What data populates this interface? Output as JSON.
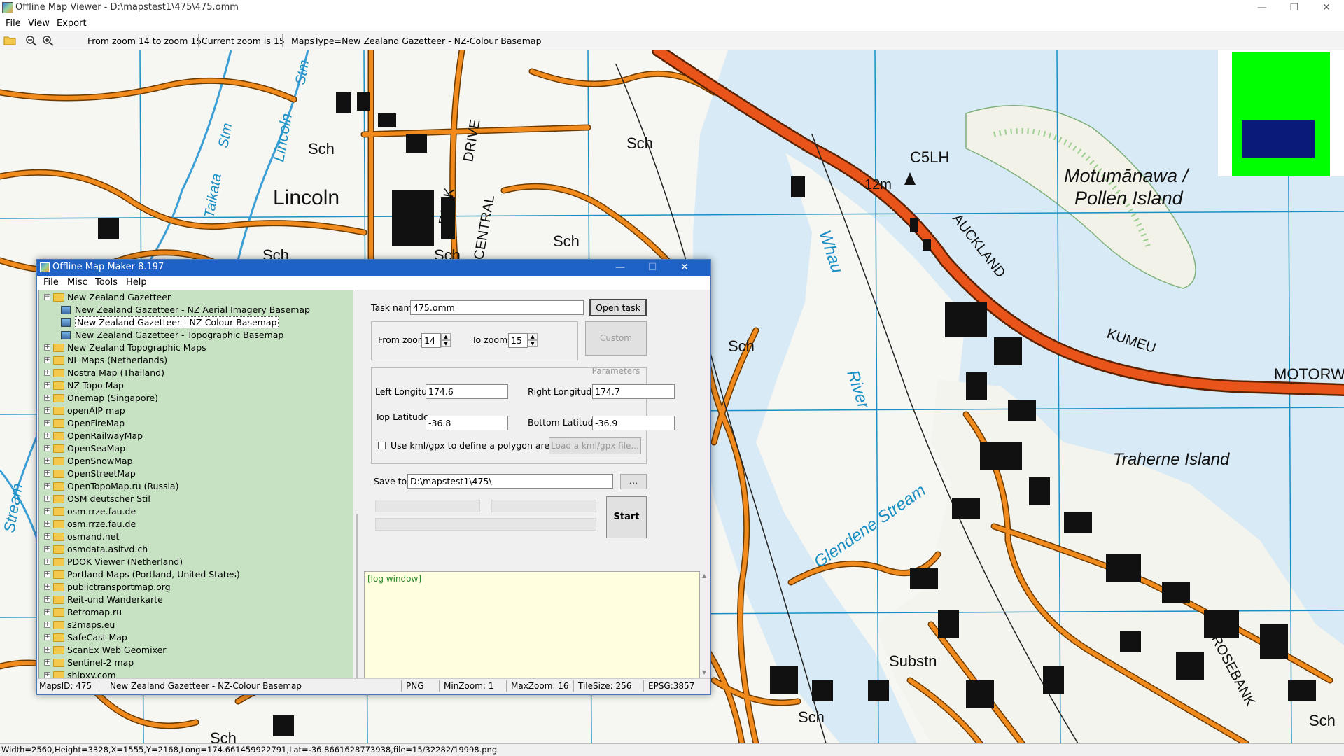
{
  "window": {
    "title": "Offline Map Viewer - D:\\mapstest1\\475\\475.omm",
    "controls": {
      "minimize": "—",
      "maximize": "❐",
      "close": "✕"
    }
  },
  "menu": [
    "File",
    "View",
    "Export"
  ],
  "toolbar": {
    "zoom_range": "From zoom 14 to zoom 15",
    "current_zoom": "Current zoom is 15",
    "maps_type": "MapsType=New Zealand Gazetteer - NZ-Colour Basemap",
    "icons": [
      "open-folder-icon",
      "zoom-out-icon",
      "zoom-in-icon"
    ]
  },
  "map_labels": [
    "Lincoln",
    "Sch",
    "Sch",
    "Sch",
    "Sch",
    "Sch",
    "Sch",
    "Sch",
    "Sch",
    "Sch",
    "C5LH",
    "12m",
    "Motumānawa /",
    "Pollen Island",
    "AUCKLAND",
    "KUMEU",
    "MOTORW",
    "Traherne Island",
    "Whau",
    "River",
    "Glendene Stream",
    "Substn",
    "ROSEBANK",
    "Stream",
    "Stm",
    "Lincoln",
    "Stm",
    "Taikata",
    "PARK",
    "CENTRAL",
    "DRIVE"
  ],
  "colors": {
    "road": "#f08a1c",
    "motorway": "#e8541a",
    "water": "#d7eaf5",
    "grid": "#1a8fc4",
    "minimap_bg": "#00ff00",
    "minimap_view": "#0a1a78",
    "tree_bg": "#c7e2c3",
    "log_bg": "#ffffe0",
    "dialog_title": "#1f62c7"
  },
  "status_bar": "Width=2560,Height=3328,X=1555,Y=2168,Long=174.661459922791,Lat=-36.8661628773938,file=15/32282/19998.png",
  "dialog": {
    "title": "Offline Map Maker 8.197",
    "menu": [
      "File",
      "Misc",
      "Tools",
      "Help"
    ],
    "tree": {
      "root": "New Zealand Gazetteer",
      "children": [
        "New Zealand Gazetteer - NZ Aerial Imagery Basemap",
        "New Zealand Gazetteer - NZ-Colour Basemap",
        "New Zealand Gazetteer - Topographic Basemap"
      ],
      "selected_child": 1,
      "items": [
        "New Zealand Topographic Maps",
        "NL Maps (Netherlands)",
        "Nostra Map (Thailand)",
        "NZ Topo Map",
        "Onemap (Singapore)",
        "openAIP map",
        "OpenFireMap",
        "OpenRailwayMap",
        "OpenSeaMap",
        "OpenSnowMap",
        "OpenStreetMap",
        "OpenTopoMap.ru (Russia)",
        "OSM deutscher Stil",
        "osm.rrze.fau.de",
        "osm.rrze.fau.de",
        "osmand.net",
        "osmdata.asitvd.ch",
        "PDOK Viewer (Netherland)",
        "Portland Maps (Portland, United States)",
        "publictransportmap.org",
        "Reit-und Wanderkarte",
        "Retromap.ru",
        "s2maps.eu",
        "SafeCast Map",
        "ScanEx Web Geomixer",
        "Sentinel-2 map",
        "shipxy.com"
      ]
    },
    "form": {
      "task_name_label": "Task name",
      "task_name_value": "475.omm",
      "open_task_button": "Open task ...",
      "from_zoom_label": "From zoom",
      "from_zoom_value": "14",
      "to_zoom_label": "To zoom",
      "to_zoom_value": "15",
      "custom_params_button": "Custom Parameters",
      "left_lon_label": "Left Longitude",
      "left_lon_value": "174.6",
      "right_lon_label": "Right Longitude",
      "right_lon_value": "174.7",
      "top_lat_label": "Top Latitude",
      "top_lat_value": "-36.8",
      "bottom_lat_label": "Bottom Latitude",
      "bottom_lat_value": "-36.9",
      "kml_checkbox_label": "Use kml/gpx to define a polygon area",
      "load_kml_button": "Load a kml/gpx file...",
      "save_to_label": "Save to:",
      "save_to_value": "D:\\mapstest1\\475\\",
      "browse_button": "...",
      "start_button": "Start"
    },
    "log_text": "[log window]",
    "status": {
      "maps_id": "MapsID: 475",
      "maps_name": "New Zealand Gazetteer - NZ-Colour Basemap",
      "format": "PNG",
      "min_zoom": "MinZoom: 1",
      "max_zoom": "MaxZoom: 16",
      "tile_size": "TileSize: 256",
      "epsg": "EPSG:3857"
    }
  }
}
